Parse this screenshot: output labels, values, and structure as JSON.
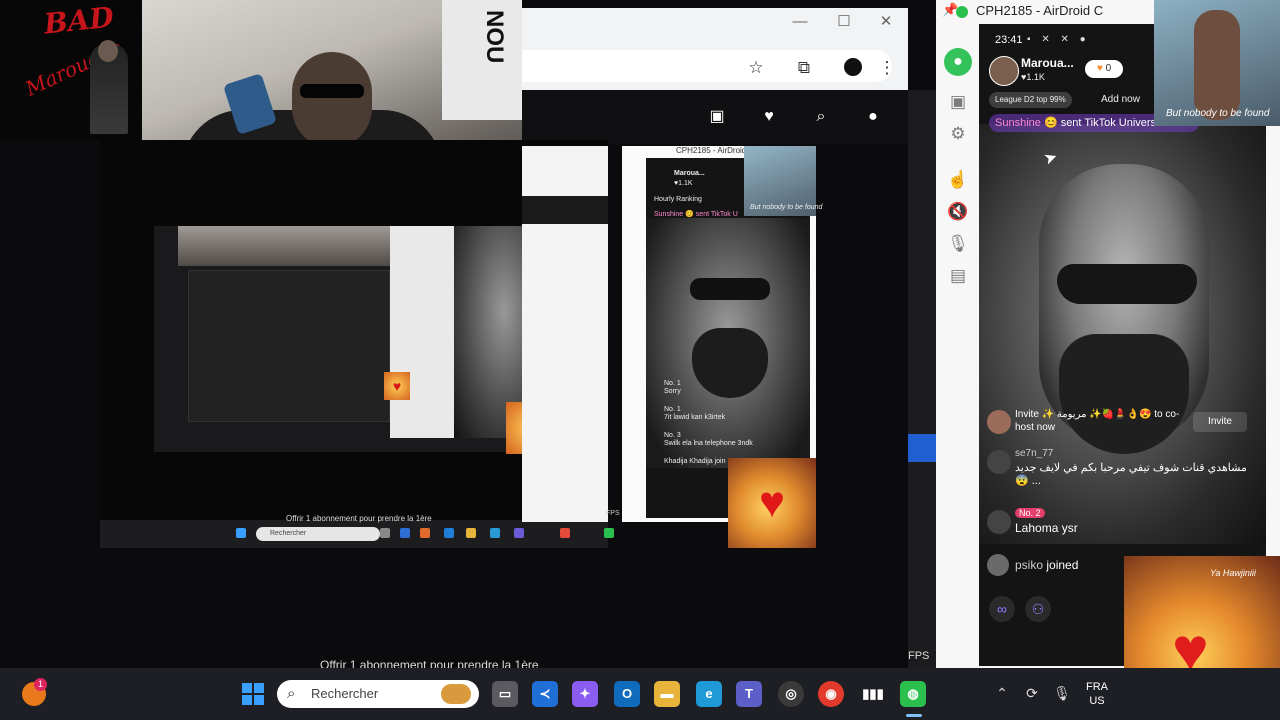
{
  "album": {
    "title_1": "BAD",
    "title_2": "Marouane"
  },
  "webcam": {
    "poster_text": "NOU"
  },
  "browser": {
    "window_controls": [
      "—",
      "☐",
      "✕"
    ],
    "toolbar_icons": [
      "star-icon",
      "extensions-icon",
      "profile-icon",
      "menu-icon"
    ],
    "site_icons": [
      "subscriptions-icon",
      "heart-icon",
      "search-icon",
      "account-icon"
    ]
  },
  "airdroid": {
    "title": "CPH2185 - AirDroid C",
    "sidebar_icons": [
      "airdroid-logo-icon",
      "screenshot-icon",
      "settings-icon",
      "touch-icon",
      "mute-icon",
      "mic-off-icon",
      "file-icon"
    ]
  },
  "tiktok": {
    "time": "23:41",
    "host_name": "Maroua...",
    "host_likes": "♥1.1K",
    "follow_count": "0",
    "league": "League D2 top 99%",
    "add_now": "Add now",
    "gift_user": "Sunshine",
    "gift_text": "😊 sent TikTok Universe to Ma",
    "invite_text": "Invite ✨ مريومة ✨🍓💄👌😍 to co-host now",
    "invite_button": "Invite",
    "comments": [
      {
        "user": "se7n_77",
        "message": "مشاهدي قنات شوف تيفي مرحبا بكم في لايف جديد ... 😨"
      },
      {
        "user": "No. 2",
        "message": "Lahoma ysr"
      }
    ],
    "joined_user": "psiko",
    "joined_text": "joined"
  },
  "cam_thumb": {
    "caption": "But nobody to be found"
  },
  "love_card": {
    "caption": "Ya Hawjiniii"
  },
  "nested": {
    "offer": "Offrir 1 abonnement pour prendre la 1ère",
    "search": "Rechercher",
    "ad_title": "CPH2185 - AirDroid C",
    "tt_name": "Maroua...",
    "tt_likes": "♥1.1K",
    "tt_ranking": "Hourly Ranking",
    "tt_gift": "Sunshine 😊 sent TikTok U",
    "tt_thumb_caption": "But nobody to be found",
    "comments": [
      {
        "user": "No. 1",
        "message": "Sorry"
      },
      {
        "user": "No. 1",
        "message": "7it lawid kan k3irtek"
      },
      {
        "user": "No. 3",
        "message": "Swilk ela lna telephone 3ndk"
      }
    ],
    "joined": "Khadija Khadija join",
    "fps": "FPS"
  },
  "fps_label": "FPS",
  "background_offer": "Offrir 1 abonnement pour prendre la 1ère",
  "taskbar": {
    "search_placeholder": "Rechercher",
    "apps": [
      "file-manager-icon",
      "vscode-icon",
      "copilot-icon",
      "outlook-icon",
      "explorer-icon",
      "edge-icon",
      "teams-icon",
      "obs-icon",
      "chrome-icon",
      "audio-app-icon",
      "airdroid-icon"
    ],
    "mango_badge": "1",
    "language": "FRA",
    "region": "US"
  }
}
